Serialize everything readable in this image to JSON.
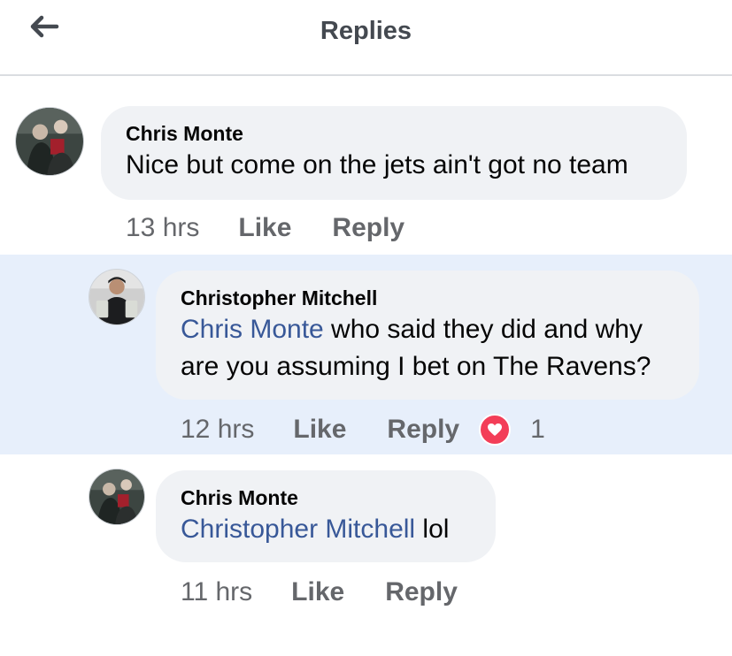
{
  "header": {
    "title": "Replies",
    "back_icon": "arrow-left-icon"
  },
  "comments": [
    {
      "author": "Chris Monte",
      "mention": "",
      "text": "Nice but come on the jets ain't got no team",
      "time": "13 hrs",
      "like": "Like",
      "reply": "Reply"
    },
    {
      "author": "Christopher Mitchell",
      "mention": "Chris Monte",
      "text": " who said they did and why are you assuming I bet on The Ravens?",
      "time": "12 hrs",
      "like": "Like",
      "reply": "Reply",
      "reaction_icon": "heart-icon",
      "reaction_count": "1",
      "highlighted": true
    },
    {
      "author": "Chris Monte",
      "mention": "Christopher Mitchell",
      "text": " lol",
      "time": "11 hrs",
      "like": "Like",
      "reply": "Reply"
    }
  ],
  "colors": {
    "mention": "#385898",
    "highlight": "#e7effb",
    "bubble": "#f0f2f5",
    "heart": "#f33e58"
  }
}
